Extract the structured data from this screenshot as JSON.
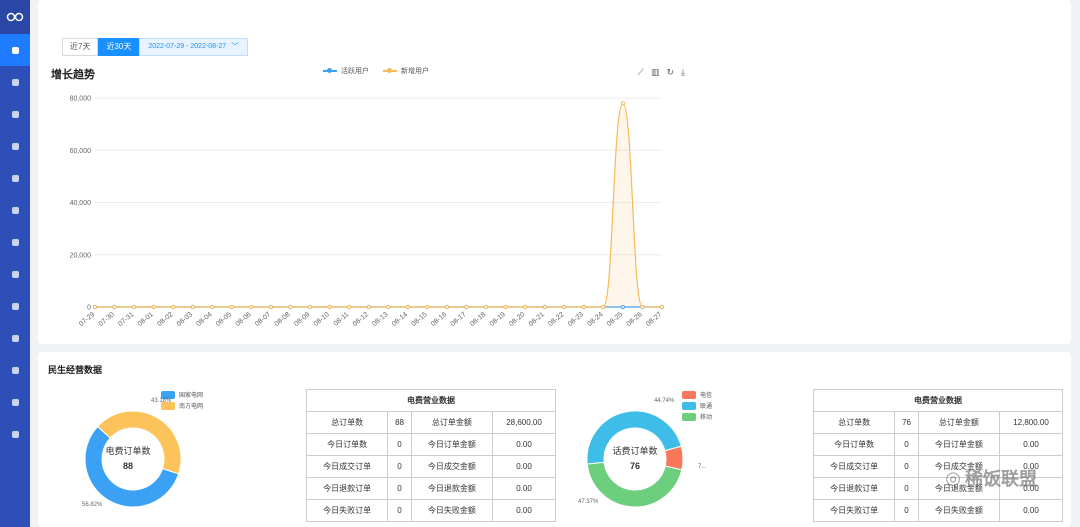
{
  "filters": {
    "btn_7": "近7天",
    "btn_30": "近30天",
    "date_range": "2022-07-29 - 2022-08-27"
  },
  "trend": {
    "title": "增长趋势",
    "legend": [
      "活跃用户",
      "新增用户"
    ],
    "toolbox": [
      "line-icon",
      "bar-icon",
      "refresh-icon",
      "download-icon"
    ]
  },
  "chart_data": [
    {
      "type": "line",
      "title": "增长趋势",
      "categories": [
        "07-29",
        "07-30",
        "07-31",
        "08-01",
        "08-02",
        "08-03",
        "08-04",
        "08-05",
        "08-06",
        "08-07",
        "08-08",
        "08-09",
        "08-10",
        "08-11",
        "08-12",
        "08-13",
        "08-14",
        "08-15",
        "08-16",
        "08-17",
        "08-18",
        "08-19",
        "08-20",
        "08-21",
        "08-22",
        "08-23",
        "08-24",
        "08-25",
        "08-26",
        "08-27"
      ],
      "y_ticks": [
        "0",
        "20,000",
        "40,000",
        "60,000",
        "80,000"
      ],
      "ylim": [
        0,
        80000
      ],
      "series": [
        {
          "name": "活跃用户",
          "color": "#3ba1f4",
          "values": [
            0,
            0,
            0,
            0,
            0,
            0,
            0,
            0,
            0,
            0,
            0,
            0,
            0,
            0,
            0,
            0,
            0,
            0,
            0,
            0,
            0,
            0,
            0,
            0,
            0,
            0,
            0,
            0,
            0,
            0
          ]
        },
        {
          "name": "新增用户",
          "color": "#f7b955",
          "values": [
            0,
            0,
            0,
            0,
            0,
            0,
            0,
            0,
            0,
            0,
            0,
            0,
            0,
            0,
            0,
            0,
            0,
            0,
            0,
            0,
            0,
            0,
            0,
            0,
            0,
            0,
            0,
            78000,
            0,
            0
          ]
        }
      ]
    },
    {
      "type": "pie",
      "title": "电费订单数",
      "total": "88",
      "slices": [
        {
          "name": "国家电网",
          "value": 56.82,
          "label": "56.82%",
          "color": "#3ba1f4"
        },
        {
          "name": "南方电网",
          "value": 43.18,
          "label": "43.18%",
          "color": "#fcc35a"
        }
      ]
    },
    {
      "type": "pie",
      "title": "话费订单数",
      "total": "76",
      "slices": [
        {
          "name": "移动",
          "value": 44.74,
          "label": "44.74%",
          "color": "#6ccf7d"
        },
        {
          "name": "联通",
          "value": 47.37,
          "label": "47.37%",
          "color": "#3fbde9"
        },
        {
          "name": "电信",
          "value": 7.89,
          "label": "7...",
          "color": "#f7785b"
        }
      ]
    }
  ],
  "bottom": {
    "title": "民生经营数据",
    "donut1": {
      "title": "电费订单数",
      "total": "88",
      "legend": [
        "国家电网",
        "南方电网"
      ],
      "pct_a": "43.18%",
      "pct_b": "56.82%"
    },
    "donut2": {
      "title": "话费订单数",
      "total": "76",
      "legend": [
        "电信",
        "联通",
        "移动"
      ],
      "pct_a": "44.74%",
      "pct_b": "47.37%",
      "pct_c": "7..."
    },
    "table1": {
      "title": "电费营业数据",
      "rows": [
        [
          "总订单数",
          "88",
          "总订单金额",
          "28,600.00"
        ],
        [
          "今日订单数",
          "0",
          "今日订单金额",
          "0.00"
        ],
        [
          "今日成交订单",
          "0",
          "今日成交金额",
          "0.00"
        ],
        [
          "今日退款订单",
          "0",
          "今日退款金额",
          "0.00"
        ],
        [
          "今日失败订单",
          "0",
          "今日失败金额",
          "0.00"
        ]
      ]
    },
    "table2": {
      "title": "电费营业数据",
      "rows": [
        [
          "总订单数",
          "76",
          "总订单金额",
          "12,800.00"
        ],
        [
          "今日订单数",
          "0",
          "今日订单金额",
          "0.00"
        ],
        [
          "今日成交订单",
          "0",
          "今日成交金额",
          "0.00"
        ],
        [
          "今日退款订单",
          "0",
          "今日退款金额",
          "0.00"
        ],
        [
          "今日失败订单",
          "0",
          "今日失败金额",
          "0.00"
        ]
      ]
    }
  },
  "watermark": "稀饭联盟"
}
